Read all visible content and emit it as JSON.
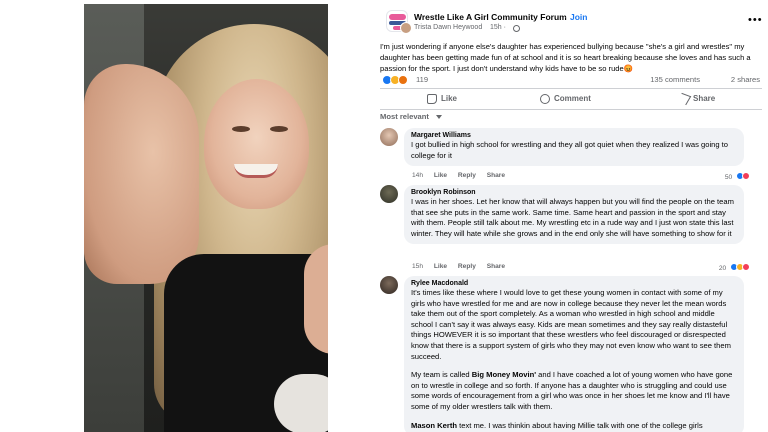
{
  "post": {
    "group_name": "Wrestle Like A Girl Community Forum",
    "join_label": "Join",
    "author": "Trista Dawn Heywood",
    "time": "15h",
    "text": "I'm just wondering if anyone else's daughter has experienced bullying because \"she's a girl and wrestles\" my daughter has been getting made fun of at school and it is so heart breaking because she loves and has such a passion for the sport. I just don't understand why kids have to be so rude😡",
    "reaction_count": "119",
    "comments_count": "135 comments",
    "shares_count": "2 shares",
    "actions": {
      "like": "Like",
      "comment": "Comment",
      "share": "Share"
    },
    "sort_label": "Most relevant"
  },
  "comments": [
    {
      "name": "Margaret Williams",
      "body": "I got bullied in high school for wrestling and they all got quiet when they realized I was going to college for it",
      "time": "14h",
      "like": "Like",
      "reply": "Reply",
      "share": "Share",
      "reactions": "50"
    },
    {
      "name": "Brooklyn Robinson",
      "body": "I was in her shoes. Let her know that will always happen but you will find the people on the team that see she puts in the same work. Same time. Same heart and passion in the sport and stay with them. People still talk about me. My wrestling etc in a rude way and I just won state this last winter. They will hate while she grows and in the end only she will have something to show for it",
      "time": "15h",
      "like": "Like",
      "reply": "Reply",
      "share": "Share",
      "reactions": "20"
    },
    {
      "name": "Rylee Macdonald",
      "body_p1": "It's times like these where I would love to get these young women in contact with some of my girls who have wrestled for me and are now in college because they never let the mean words take them out of the sport completely. As a woman who wrestled in high school and middle school I can't say it was always easy. Kids are mean sometimes and they say really distasteful things HOWEVER it is so important that these wrestlers who feel discouraged or disrespected know that there is a support system of girls who they may not even know who want to see them succeed.",
      "body_p2_pre": "My team is called ",
      "body_p2_bold": "Big Money Movin'",
      "body_p2_post": " and I have coached a lot of young women who have gone on to wrestle in college and so forth. If anyone has a daughter who is struggling and could use some words of encouragement from a girl who was once in her shoes let me know and I'll have some of my older wrestlers talk with them.",
      "body_p3_bold": "Mason Kerth",
      "body_p3_post": " text me. I was thinkin about having Millie talk with one of the college girls"
    }
  ],
  "colors": {
    "brand_blue": "#1877f2",
    "bubble_bg": "#f0f2f5",
    "secondary_text": "#65676b"
  },
  "icons": [
    "group-logo-icon",
    "globe-icon",
    "more-icon",
    "like-icon",
    "comment-icon",
    "share-icon",
    "chevron-down-icon"
  ]
}
